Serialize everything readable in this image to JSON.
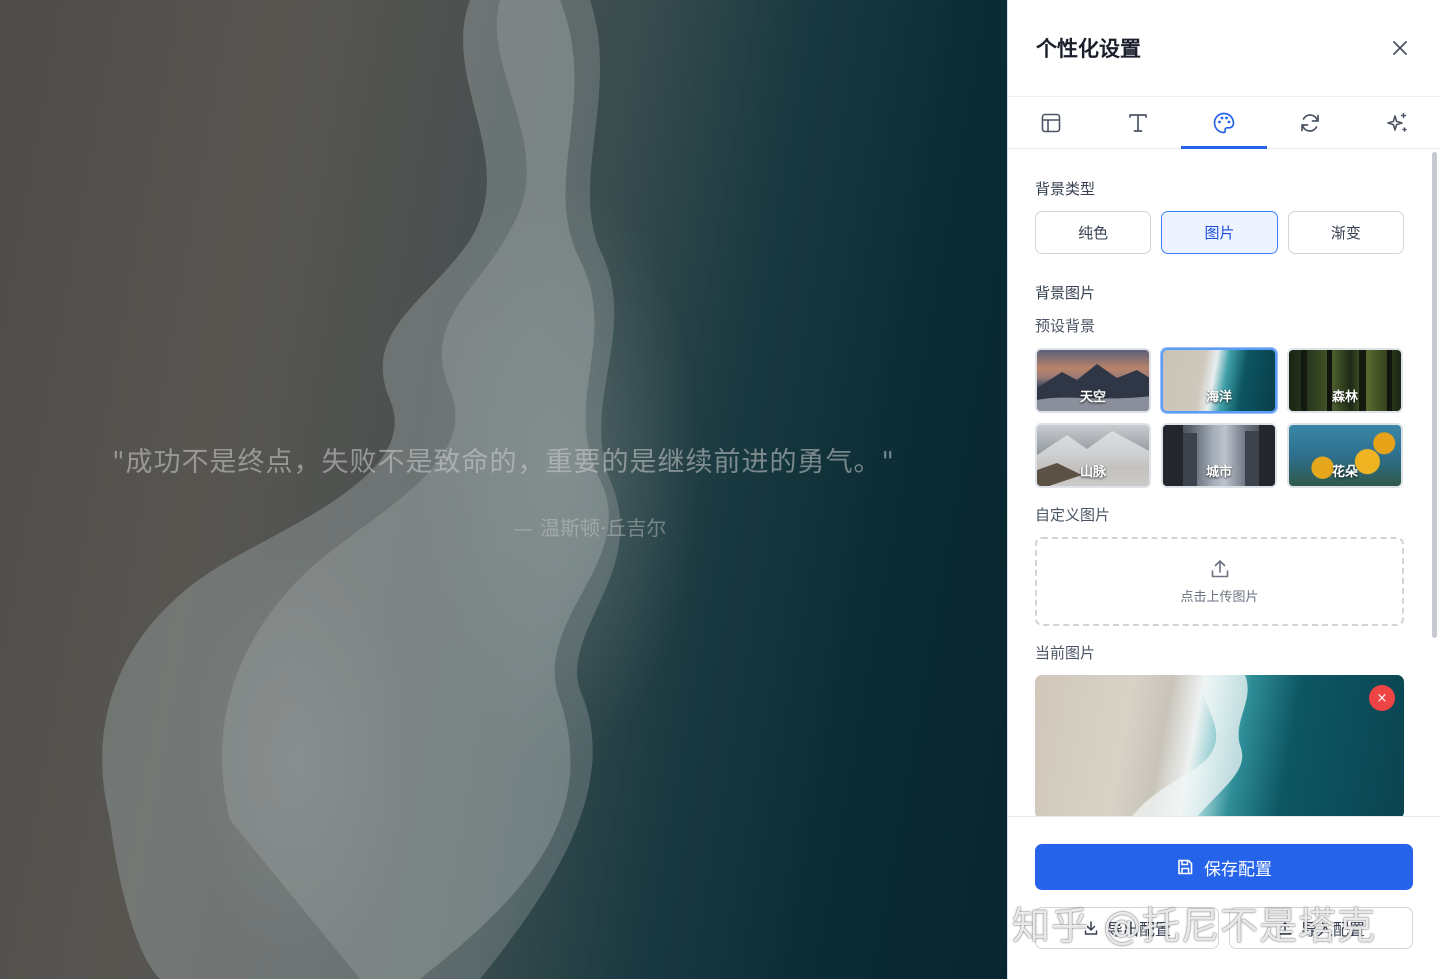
{
  "background": {
    "quote": "\"成功不是终点，失败不是致命的，重要的是继续前进的勇气。\"",
    "author": "— 温斯顿·丘吉尔"
  },
  "panel": {
    "title": "个性化设置",
    "tabs": [
      {
        "icon": "layout-icon",
        "active": false
      },
      {
        "icon": "text-icon",
        "active": false
      },
      {
        "icon": "palette-icon",
        "active": true
      },
      {
        "icon": "refresh-icon",
        "active": false
      },
      {
        "icon": "sparkles-icon",
        "active": false
      }
    ],
    "background_type": {
      "label": "背景类型",
      "options": [
        "纯色",
        "图片",
        "渐变"
      ],
      "selected": "图片"
    },
    "background_image": {
      "label": "背景图片",
      "preset_label": "预设背景",
      "presets": [
        "天空",
        "海洋",
        "森林",
        "山脉",
        "城市",
        "花朵"
      ],
      "selected_preset": "海洋",
      "custom_label": "自定义图片",
      "upload_text": "点击上传图片",
      "current_label": "当前图片",
      "remove_symbol": "×"
    },
    "footer": {
      "save_label": "保存配置",
      "export_label": "导出配置",
      "import_label": "导入配置"
    }
  },
  "watermark": "知乎 @托尼不是塔克",
  "colors": {
    "accent": "#2563eb",
    "selected_border": "#3b82f6",
    "remove": "#ef4444"
  }
}
